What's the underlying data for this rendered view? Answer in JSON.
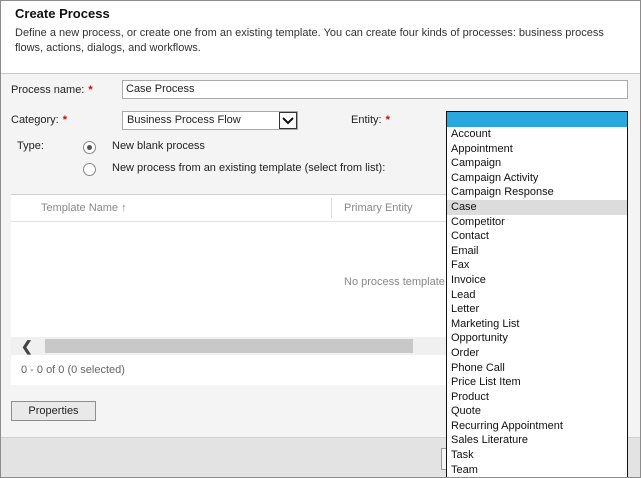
{
  "dialog": {
    "title": "Create Process",
    "description": "Define a new process, or create one from an existing template. You can create four kinds of processes: business process flows, actions, dialogs, and workflows."
  },
  "form": {
    "process_name_label": "Process name:",
    "process_name_value": "Case Process",
    "category_label": "Category:",
    "category_value": "Business Process Flow",
    "entity_label": "Entity:",
    "required_marker": "*",
    "type_label": "Type:",
    "type_options": [
      {
        "label": "New blank process",
        "selected": true
      },
      {
        "label": "New process from an existing template (select from list):",
        "selected": false
      }
    ]
  },
  "template_grid": {
    "columns": [
      "Template Name ↑",
      "Primary Entity"
    ],
    "empty_message": "No process template",
    "record_count": "0 - 0 of 0 (0 selected)"
  },
  "properties_button": "Properties",
  "entity_dropdown": {
    "selected": "Case",
    "options": [
      "Account",
      "Appointment",
      "Campaign",
      "Campaign Activity",
      "Campaign Response",
      "Case",
      "Competitor",
      "Contact",
      "Email",
      "Fax",
      "Invoice",
      "Lead",
      "Letter",
      "Marketing List",
      "Opportunity",
      "Order",
      "Phone Call",
      "Price List Item",
      "Product",
      "Quote",
      "Recurring Appointment",
      "Sales Literature",
      "Task",
      "Team"
    ]
  },
  "colors": {
    "dropdown_highlight": "#2aa7df",
    "selected_item": "#dcdcdc",
    "required": "#dd0000"
  },
  "icons": {
    "dropdown_arrow": "chevron-down-icon",
    "scroll_left": "chevron-left-icon"
  }
}
